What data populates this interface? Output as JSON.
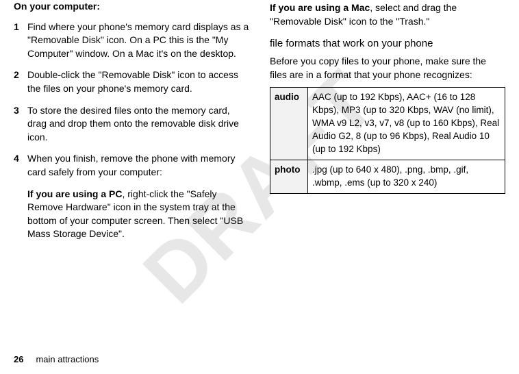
{
  "watermark": "DRAFT",
  "left": {
    "intro": "On your computer:",
    "steps": [
      "Find where your phone's memory card displays as a \"Removable Disk\" icon. On a PC this is the \"My Computer\" window. On a Mac it's on the desktop.",
      "Double-click the \"Removable Disk\" icon to access the files on your phone's memory card.",
      "To store the desired files onto the memory card, drag and drop them onto the removable disk drive icon.",
      "When you finish, remove the phone with memory card safely from your computer:"
    ],
    "pc_lead": "If you are using a PC",
    "pc_rest": ", right-click the \"Safely Remove Hardware\" icon in the system tray at the bottom of your computer screen. Then select \"USB Mass Storage Device\"."
  },
  "right": {
    "mac_lead": "If you are using a Mac",
    "mac_rest": ", select and drag the \"Removable Disk\" icon to the \"Trash.\"",
    "heading": "file formats that work on your phone",
    "para": "Before you copy files to your phone, make sure the files are in a format that your phone recognizes:",
    "table": {
      "rows": [
        {
          "label": "audio",
          "value": "AAC (up to 192 Kbps), AAC+ (16 to 128 Kbps), MP3 (up to 320 Kbps, WAV (no limit), WMA v9 L2, v3, v7, v8 (up to 160 Kbps), Real Audio G2, 8 (up to 96 Kbps), Real Audio 10 (up to 192 Kbps)"
        },
        {
          "label": "photo",
          "value": ".jpg (up to 640 x 480), .png, .bmp, .gif, .wbmp, .ems (up to 320 x 240)"
        }
      ]
    }
  },
  "footer": {
    "page": "26",
    "section": "main attractions"
  }
}
